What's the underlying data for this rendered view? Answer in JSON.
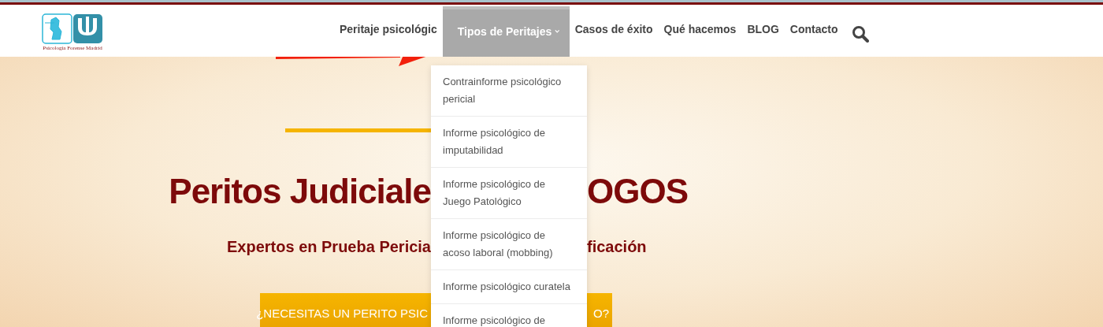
{
  "logo": {
    "caption": "Psicología Forense Madrid"
  },
  "nav": {
    "items": [
      {
        "label": "Peritaje psicológic",
        "selected": false,
        "dropdown": false
      },
      {
        "label": "Tipos de Peritajes",
        "selected": true,
        "dropdown": true
      },
      {
        "label": "Casos de éxito",
        "selected": false,
        "dropdown": false
      },
      {
        "label": "Qué hacemos",
        "selected": false,
        "dropdown": false
      },
      {
        "label": "BLOG",
        "selected": false,
        "dropdown": false
      },
      {
        "label": "Contacto",
        "selected": false,
        "dropdown": false
      }
    ]
  },
  "dropdown_menu": {
    "items": [
      {
        "label": "Contrainforme psicológico pericial"
      },
      {
        "label": "Informe psicológico de imputabilidad"
      },
      {
        "label": "Informe psicológico de Juego Patológico"
      },
      {
        "label": "Informe psicológico de acoso laboral (mobbing)"
      },
      {
        "label": "Informe psicológico curatela"
      },
      {
        "label": "Informe psicológico de"
      }
    ]
  },
  "hero": {
    "title_left": "Peritos Judiciale",
    "title_right": "OGOS",
    "subtitle_left": "Expertos en Prueba Pericia",
    "subtitle_right": "ficación",
    "button_left": "¿NECESITAS UN PERITO PSIC",
    "button_right": "O?"
  }
}
